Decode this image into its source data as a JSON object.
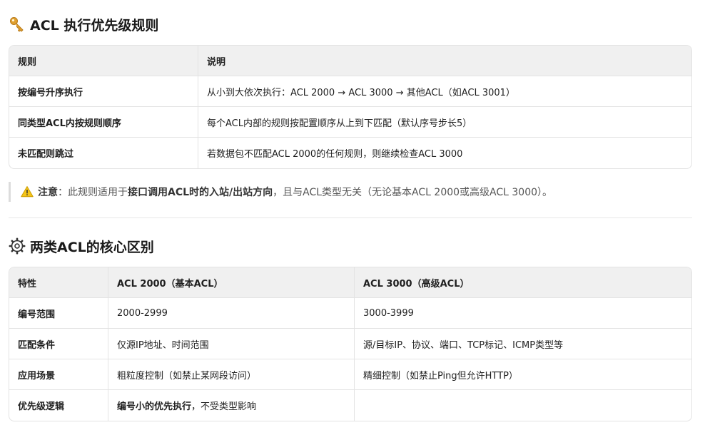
{
  "section1": {
    "title": "ACL 执行优先级规则",
    "headers": [
      "规则",
      "说明"
    ],
    "rows": [
      {
        "rule": "按编号升序执行",
        "desc": "从小到大依次执行：ACL 2000 → ACL 3000 → 其他ACL（如ACL 3001）"
      },
      {
        "rule": "同类型ACL内按规则顺序",
        "desc": "每个ACL内部的规则按配置顺序从上到下匹配（默认序号步长5）"
      },
      {
        "rule": "未匹配则跳过",
        "desc": "若数据包不匹配ACL 2000的任何规则，则继续检查ACL 3000"
      }
    ]
  },
  "note": {
    "label": "注意",
    "text_before": "：此规则适用于",
    "bold_text": "接口调用ACL时的入站/出站方向",
    "text_after": "，且与ACL类型无关（无论基本ACL 2000或高级ACL 3000）。"
  },
  "section2": {
    "title": "两类ACL的核心区别",
    "headers": [
      "特性",
      "ACL 2000（基本ACL）",
      "ACL 3000（高级ACL）"
    ],
    "rows": [
      {
        "feature": "编号范围",
        "basic": "2000-2999",
        "advanced": "3000-3999"
      },
      {
        "feature": "匹配条件",
        "basic": "仅源IP地址、时间范围",
        "advanced": "源/目标IP、协议、端口、TCP标记、ICMP类型等"
      },
      {
        "feature": "应用场景",
        "basic": "粗粒度控制（如禁止某网段访问）",
        "advanced": "精细控制（如禁止Ping但允许HTTP）"
      },
      {
        "feature": "优先级逻辑",
        "basic_bold": "编号小的优先执行",
        "basic_rest": "，不受类型影响",
        "advanced": ""
      }
    ]
  },
  "icons": {
    "section1": "key-icon",
    "note": "warning-icon",
    "section2": "gear-icon"
  }
}
